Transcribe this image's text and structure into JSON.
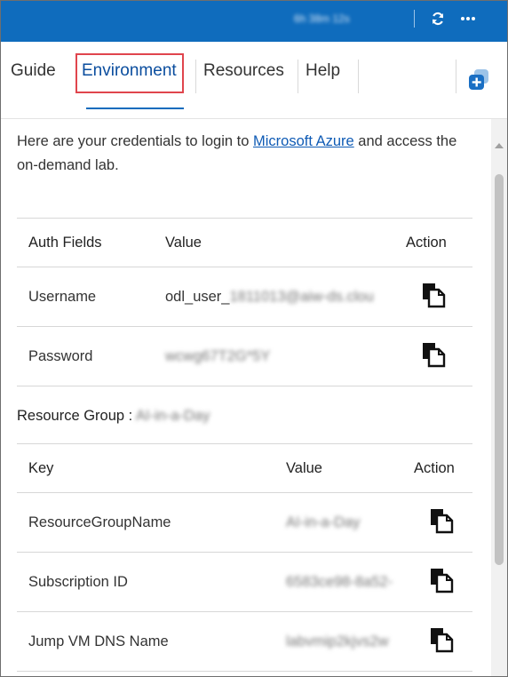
{
  "topbar": {
    "timer": "6h 38m 12s",
    "refresh_icon": "refresh-icon",
    "more_icon": "more-icon"
  },
  "tabs": [
    {
      "label": "Guide"
    },
    {
      "label": "Environment"
    },
    {
      "label": "Resources"
    },
    {
      "label": "Help"
    }
  ],
  "intro": {
    "before": "Here are your credentials to login to ",
    "link": "Microsoft Azure",
    "after": " and access the on-demand lab."
  },
  "credentials": {
    "headers": [
      "Auth Fields",
      "Value",
      "Action"
    ],
    "rows": [
      {
        "field": "Username",
        "value_prefix": "odl_user_",
        "value_hidden": "1811013@aiw-ds.clou",
        "action_icon": "copy-icon"
      },
      {
        "field": "Password",
        "value_hidden": "wcwg67T2G*5Y",
        "action_icon": "copy-icon"
      }
    ]
  },
  "resource_group": {
    "label": "Resource Group : ",
    "value": "AI-in-a-Day",
    "headers": [
      "Key",
      "Value",
      "Action"
    ],
    "rows": [
      {
        "key": "ResourceGroupName",
        "value": "AI-in-a-Day",
        "action_icon": "copy-icon"
      },
      {
        "key": "Subscription ID",
        "value": "6583ce98-8a52-",
        "action_icon": "copy-icon"
      },
      {
        "key": "Jump VM DNS Name",
        "value": "labvmip2kjvs2w",
        "action_icon": "copy-icon"
      }
    ]
  },
  "colors": {
    "topbar": "#0f6cbd",
    "active_tab": "#0a4d9e",
    "highlight_outline": "#e0454d",
    "link": "#0f5bb5"
  }
}
